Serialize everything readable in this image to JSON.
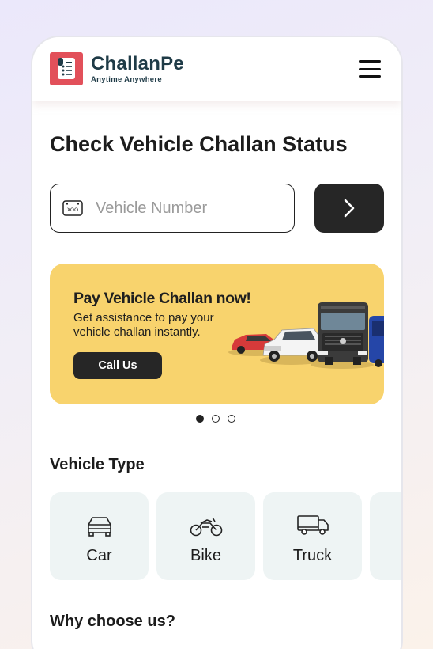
{
  "brand": {
    "name": "ChallanPe",
    "tagline": "Anytime Anywhere",
    "accent": "#e2505a",
    "text_color": "#1f3b47"
  },
  "header": {
    "menu_icon": "hamburger-menu-icon"
  },
  "page": {
    "title": "Check Vehicle Challan Status"
  },
  "search": {
    "placeholder": "Vehicle Number",
    "value": "",
    "leading_icon": "license-plate-icon",
    "submit_icon": "chevron-right-icon"
  },
  "banner": {
    "title": "Pay Vehicle Challan now!",
    "subtitle": "Get assistance to pay your vehicle challan instantly.",
    "button_label": "Call Us",
    "background": "#f8d36d",
    "slides_total": 3,
    "active_slide": 1
  },
  "vehicle_type": {
    "heading": "Vehicle Type",
    "items": [
      {
        "label": "Car",
        "icon": "car-icon"
      },
      {
        "label": "Bike",
        "icon": "bike-icon"
      },
      {
        "label": "Truck",
        "icon": "truck-icon"
      }
    ]
  },
  "why_choose": {
    "heading": "Why choose us?"
  }
}
